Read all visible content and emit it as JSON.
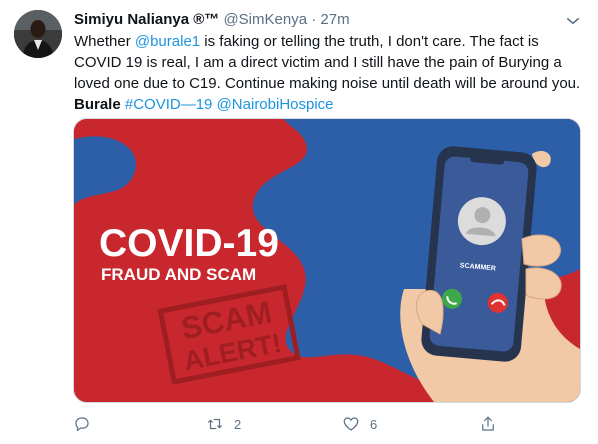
{
  "tweet": {
    "author_name": "Simiyu Nalianya ®™",
    "author_handle": "@SimKenya",
    "separator": "·",
    "time": "27m",
    "text_part1": "Whether ",
    "mention": "@burale1",
    "text_part2": " is faking or telling the truth, I don't care. The fact is COVID 19 is real, I am a direct victim and I still have the pain of Burying a loved one due to C19. Continue making noise until death will be around you.",
    "bold_word": "Burale",
    "hashtag": "#COVID—19",
    "mention2": "@NairobiHospice"
  },
  "media": {
    "headline": "COVID-19",
    "subheadline": "FRAUD AND SCAM",
    "stamp_line1": "SCAM",
    "stamp_line2": "ALERT!",
    "caller_label": "SCAMMER",
    "colors": {
      "background": "#c8282d",
      "blob": "#2c5fa8",
      "phone": "#27344d",
      "accept": "#3da84a",
      "decline": "#e0332f"
    }
  },
  "actions": {
    "reply_count": "",
    "retweet_count": "2",
    "like_count": "6",
    "share_count": ""
  },
  "icons": [
    "avatar",
    "chevron-down-icon",
    "reply-icon",
    "retweet-icon",
    "like-icon",
    "share-icon",
    "phone-accept-icon",
    "phone-decline-icon",
    "person-icon"
  ]
}
